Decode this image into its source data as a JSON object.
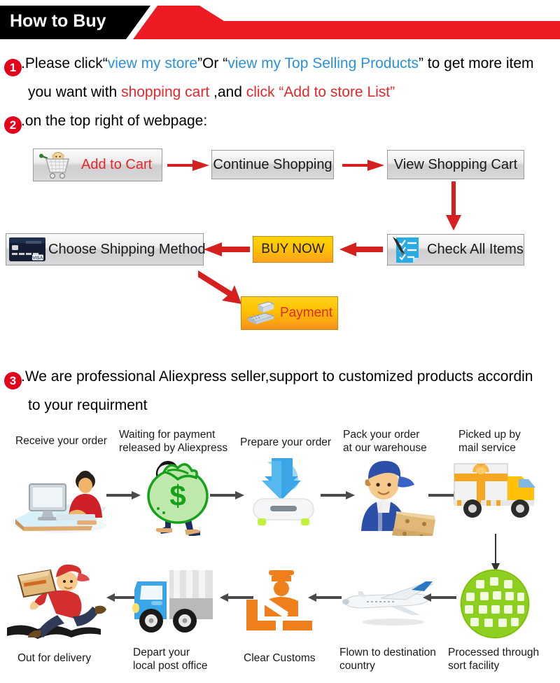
{
  "header": {
    "title": "How to Buy",
    "black_color": "#000000",
    "red_color": "#ed1c24"
  },
  "instructions": [
    {
      "number": "1",
      "line1_part1": ".Please click",
      "line1_quote_open": "“",
      "line1_link1": "view my store",
      "line1_mid": "”Or “",
      "line1_link2": "view my Top Selling Products",
      "line1_end": "” to get more item",
      "line2_part1": "you want with ",
      "line2_red1": "shopping cart",
      "line2_mid": " ,and ",
      "line2_red2": "click “Add to store List”"
    },
    {
      "number": "2",
      "line1": ".on the top right of webpage:"
    },
    {
      "number": "3",
      "line1": ".We are professional Aliexpress seller,support to customized products accordin",
      "line2": "to your requirment"
    }
  ],
  "buy_flow": {
    "buttons": [
      {
        "id": "add-to-cart",
        "label": "Add to Cart",
        "icon": "shopping-cart-icon",
        "style": "grey-red-text"
      },
      {
        "id": "continue-shopping",
        "label": "Continue Shopping",
        "icon": "",
        "style": "grey"
      },
      {
        "id": "view-shopping-cart",
        "label": "View Shopping Cart",
        "icon": "",
        "style": "grey"
      },
      {
        "id": "check-all-items",
        "label": "Check All Items",
        "icon": "checklist-pen-icon",
        "style": "grey"
      },
      {
        "id": "buy-now",
        "label": "BUY NOW",
        "icon": "",
        "style": "orange"
      },
      {
        "id": "choose-shipping-method",
        "label": "Choose Shipping Method",
        "icon": "credit-card-icon",
        "style": "grey"
      },
      {
        "id": "payment",
        "label": "Payment",
        "icon": "cash-register-icon",
        "style": "orange-red-text"
      }
    ],
    "arrow_color": "#d6201f"
  },
  "process_flow": {
    "arrow_color": "#4a4a4a",
    "top_row": [
      {
        "label_lines": [
          "Receive your order"
        ],
        "icon": "person-at-computer-icon"
      },
      {
        "label_lines": [
          "Waiting for payment",
          "released by Aliexpress"
        ],
        "icon": "money-bag-icon"
      },
      {
        "label_lines": [
          "Prepare your order"
        ],
        "icon": "download-box-icon"
      },
      {
        "label_lines": [
          "Pack your order",
          "at our warehouse"
        ],
        "icon": "warehouse-worker-icon"
      },
      {
        "label_lines": [
          "Picked up by",
          "mail service"
        ],
        "icon": "delivery-truck-gift-icon"
      }
    ],
    "bottom_row": [
      {
        "label_lines": [
          "Out for delivery"
        ],
        "icon": "courier-running-icon"
      },
      {
        "label_lines": [
          "Depart your",
          "local post office"
        ],
        "icon": "blue-post-truck-icon"
      },
      {
        "label_lines": [
          "Clear Customs"
        ],
        "icon": "customs-officer-icon"
      },
      {
        "label_lines": [
          "Flown to destination",
          "country"
        ],
        "icon": "airplane-icon"
      },
      {
        "label_lines": [
          "Processed through",
          "sort facility"
        ],
        "icon": "green-globe-icon"
      }
    ]
  }
}
